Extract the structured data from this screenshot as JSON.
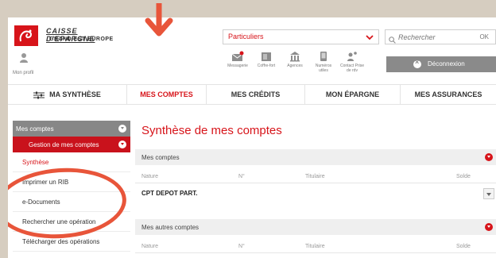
{
  "brand": {
    "line1": "CAISSE D'EPARGNE",
    "line2": "GRAND EST EUROPE",
    "color": "#d7141a"
  },
  "segment_select": {
    "value": "Particuliers"
  },
  "search": {
    "placeholder": "Rechercher",
    "ok_label": "OK"
  },
  "profile": {
    "label": "Mon profil"
  },
  "tools": [
    {
      "label": "Messagerie",
      "icon": "mail-icon"
    },
    {
      "label": "Coffre-fort",
      "icon": "safe-icon"
    },
    {
      "label": "Agences",
      "icon": "bank-icon"
    },
    {
      "label": "Numéros utiles",
      "icon": "phone-icon"
    },
    {
      "label": "Contact Prise de rdv",
      "icon": "contact-icon"
    }
  ],
  "logout": {
    "label": "Déconnexion"
  },
  "nav": [
    {
      "label": "MA SYNTHÈSE"
    },
    {
      "label": "MES COMPTES"
    },
    {
      "label": "MES CRÉDITS"
    },
    {
      "label": "MON ÉPARGNE"
    },
    {
      "label": "MES ASSURANCES"
    }
  ],
  "sidebar": {
    "header": "Mes comptes",
    "subheader": "Gestion de mes comptes",
    "items": [
      {
        "label": "Synthèse"
      },
      {
        "label": "Imprimer un RIB"
      },
      {
        "label": "e-Documents"
      },
      {
        "label": "Rechercher une opération"
      },
      {
        "label": "Télécharger des opérations"
      }
    ]
  },
  "main": {
    "title": "Synthèse de mes comptes",
    "section1": "Mes comptes",
    "columns": [
      "Nature",
      "N°",
      "Titulaire",
      "Solde"
    ],
    "account_row": "CPT DEPOT PART.",
    "section2": "Mes autres comptes"
  },
  "annotation_color": "#e8553a"
}
